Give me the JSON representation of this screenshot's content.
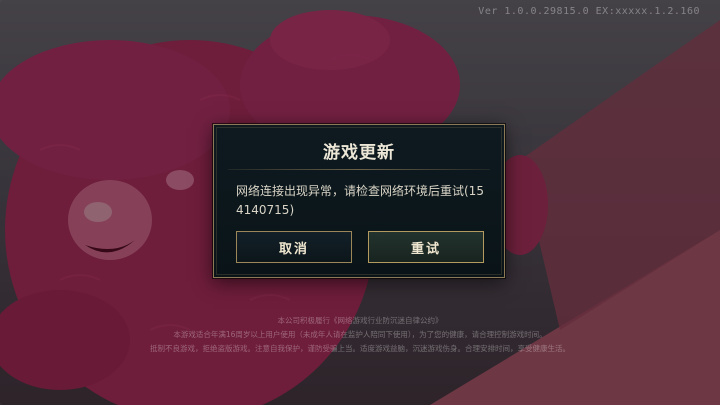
{
  "version": "Ver 1.0.0.29815.0 EX:xxxxx.1.2.160",
  "dialog": {
    "title": "游戏更新",
    "message": "网络连接出现异常，请检查网络环境后重试(154140715)",
    "cancel_label": "取消",
    "retry_label": "重试"
  },
  "notice": {
    "line1": "本公司积极履行《网络游戏行业防沉迷自律公约》",
    "line2": "本游戏适合年满16周岁以上用户使用（未成年人请在监护人陪同下使用），为了您的健康，请合理控制游戏时间。",
    "line3": "抵制不良游戏，拒绝盗版游戏。注意自我保护，谨防受骗上当。适度游戏益脑，沉迷游戏伤身。合理安排时间，享受健康生活。"
  },
  "colors": {
    "dialog_border": "#8b7a55",
    "dialog_bg": "#0e1a20",
    "bear_pink": "#c23a6b"
  }
}
